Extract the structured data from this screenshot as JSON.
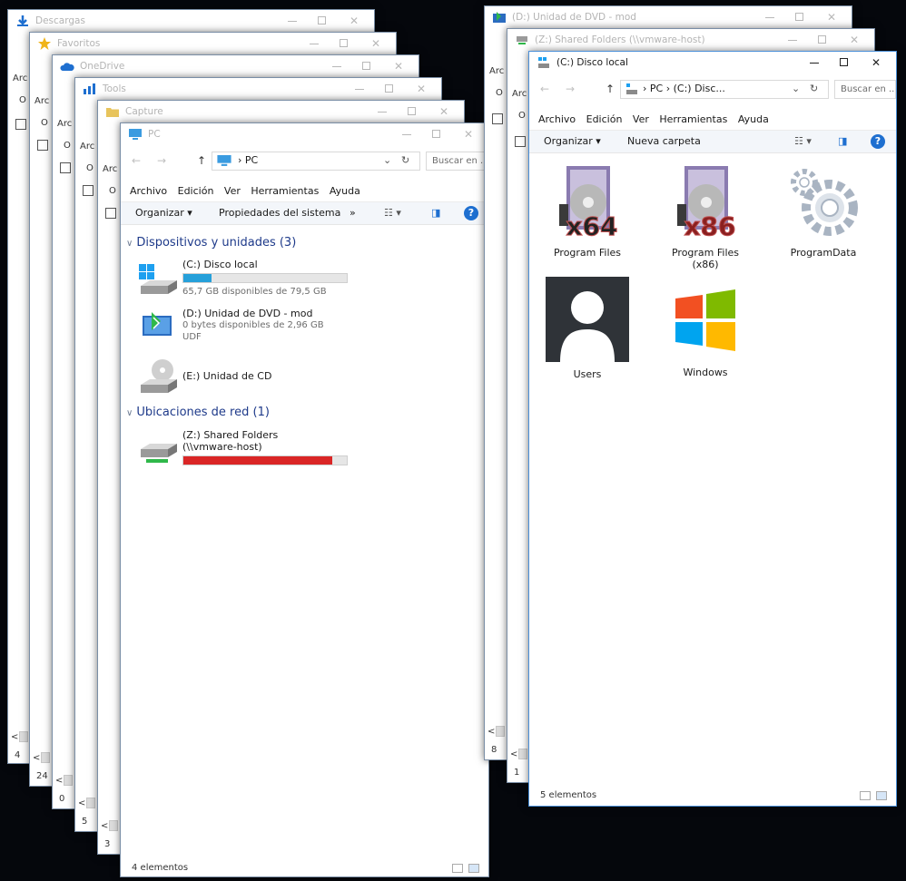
{
  "background_windows": [
    {
      "title": "Descargas",
      "icon": "download-icon",
      "count": "4"
    },
    {
      "title": "Favoritos",
      "icon": "star-icon",
      "count": "24"
    },
    {
      "title": "OneDrive",
      "icon": "cloud-icon",
      "count": "0"
    },
    {
      "title": "Tools",
      "icon": "tools-icon",
      "count": "5"
    },
    {
      "title": "Capture",
      "icon": "folder-icon",
      "count": "3"
    },
    {
      "title": "(D:) Unidad de DVD - mod",
      "icon": "dvd-icon",
      "count": "8"
    },
    {
      "title": "(Z:) Shared Folders (\\\\vmware-host)",
      "icon": "network-drive-icon",
      "count": "1"
    }
  ],
  "peek_text": {
    "arc": "Arc",
    "o": "O"
  },
  "pc_window": {
    "title": "PC",
    "breadcrumb": "PC",
    "search_placeholder": "Buscar en ...",
    "menu": [
      "Archivo",
      "Edición",
      "Ver",
      "Herramientas",
      "Ayuda"
    ],
    "toolbar": {
      "organize": "Organizar ▾",
      "properties": "Propiedades del sistema",
      "more": "»"
    },
    "devices_header": "Dispositivos y unidades (3)",
    "network_header": "Ubicaciones de red (1)",
    "drives": [
      {
        "name": "(C:) Disco local",
        "free": "65,7 GB disponibles de 79,5 GB",
        "fill_fraction": 0.17,
        "fill_color": "#26a0da"
      },
      {
        "name": "(D:) Unidad de DVD - mod",
        "free": "0 bytes disponibles de 2,96 GB",
        "fs": "UDF"
      },
      {
        "name": "(E:) Unidad de CD"
      }
    ],
    "network": [
      {
        "name": "(Z:) Shared Folders",
        "path": "(\\\\vmware-host)",
        "fill_fraction": 0.91,
        "fill_color": "#da2626"
      }
    ],
    "status": "4 elementos"
  },
  "c_window": {
    "title": "(C:) Disco local",
    "breadcrumb": "PC  ›  (C:) Disc...",
    "search_placeholder": "Buscar en ...",
    "menu": [
      "Archivo",
      "Edición",
      "Ver",
      "Herramientas",
      "Ayuda"
    ],
    "toolbar": {
      "organize": "Organizar ▾",
      "new_folder": "Nueva carpeta"
    },
    "items": [
      {
        "label": "Program Files",
        "overlay": "x64",
        "icon": "program-files-icon"
      },
      {
        "label": "Program Files (x86)",
        "overlay": "x86",
        "icon": "program-files-x86-icon"
      },
      {
        "label": "ProgramData",
        "icon": "gears-icon"
      },
      {
        "label": "Users",
        "icon": "user-silhouette-icon"
      },
      {
        "label": "Windows",
        "icon": "windows-logo-icon"
      }
    ],
    "status": "5 elementos"
  },
  "colors": {
    "win_accent": "#1e6fd0",
    "group_header": "#1e3a8a",
    "usage_ok": "#26a0da",
    "usage_full": "#da2626"
  }
}
